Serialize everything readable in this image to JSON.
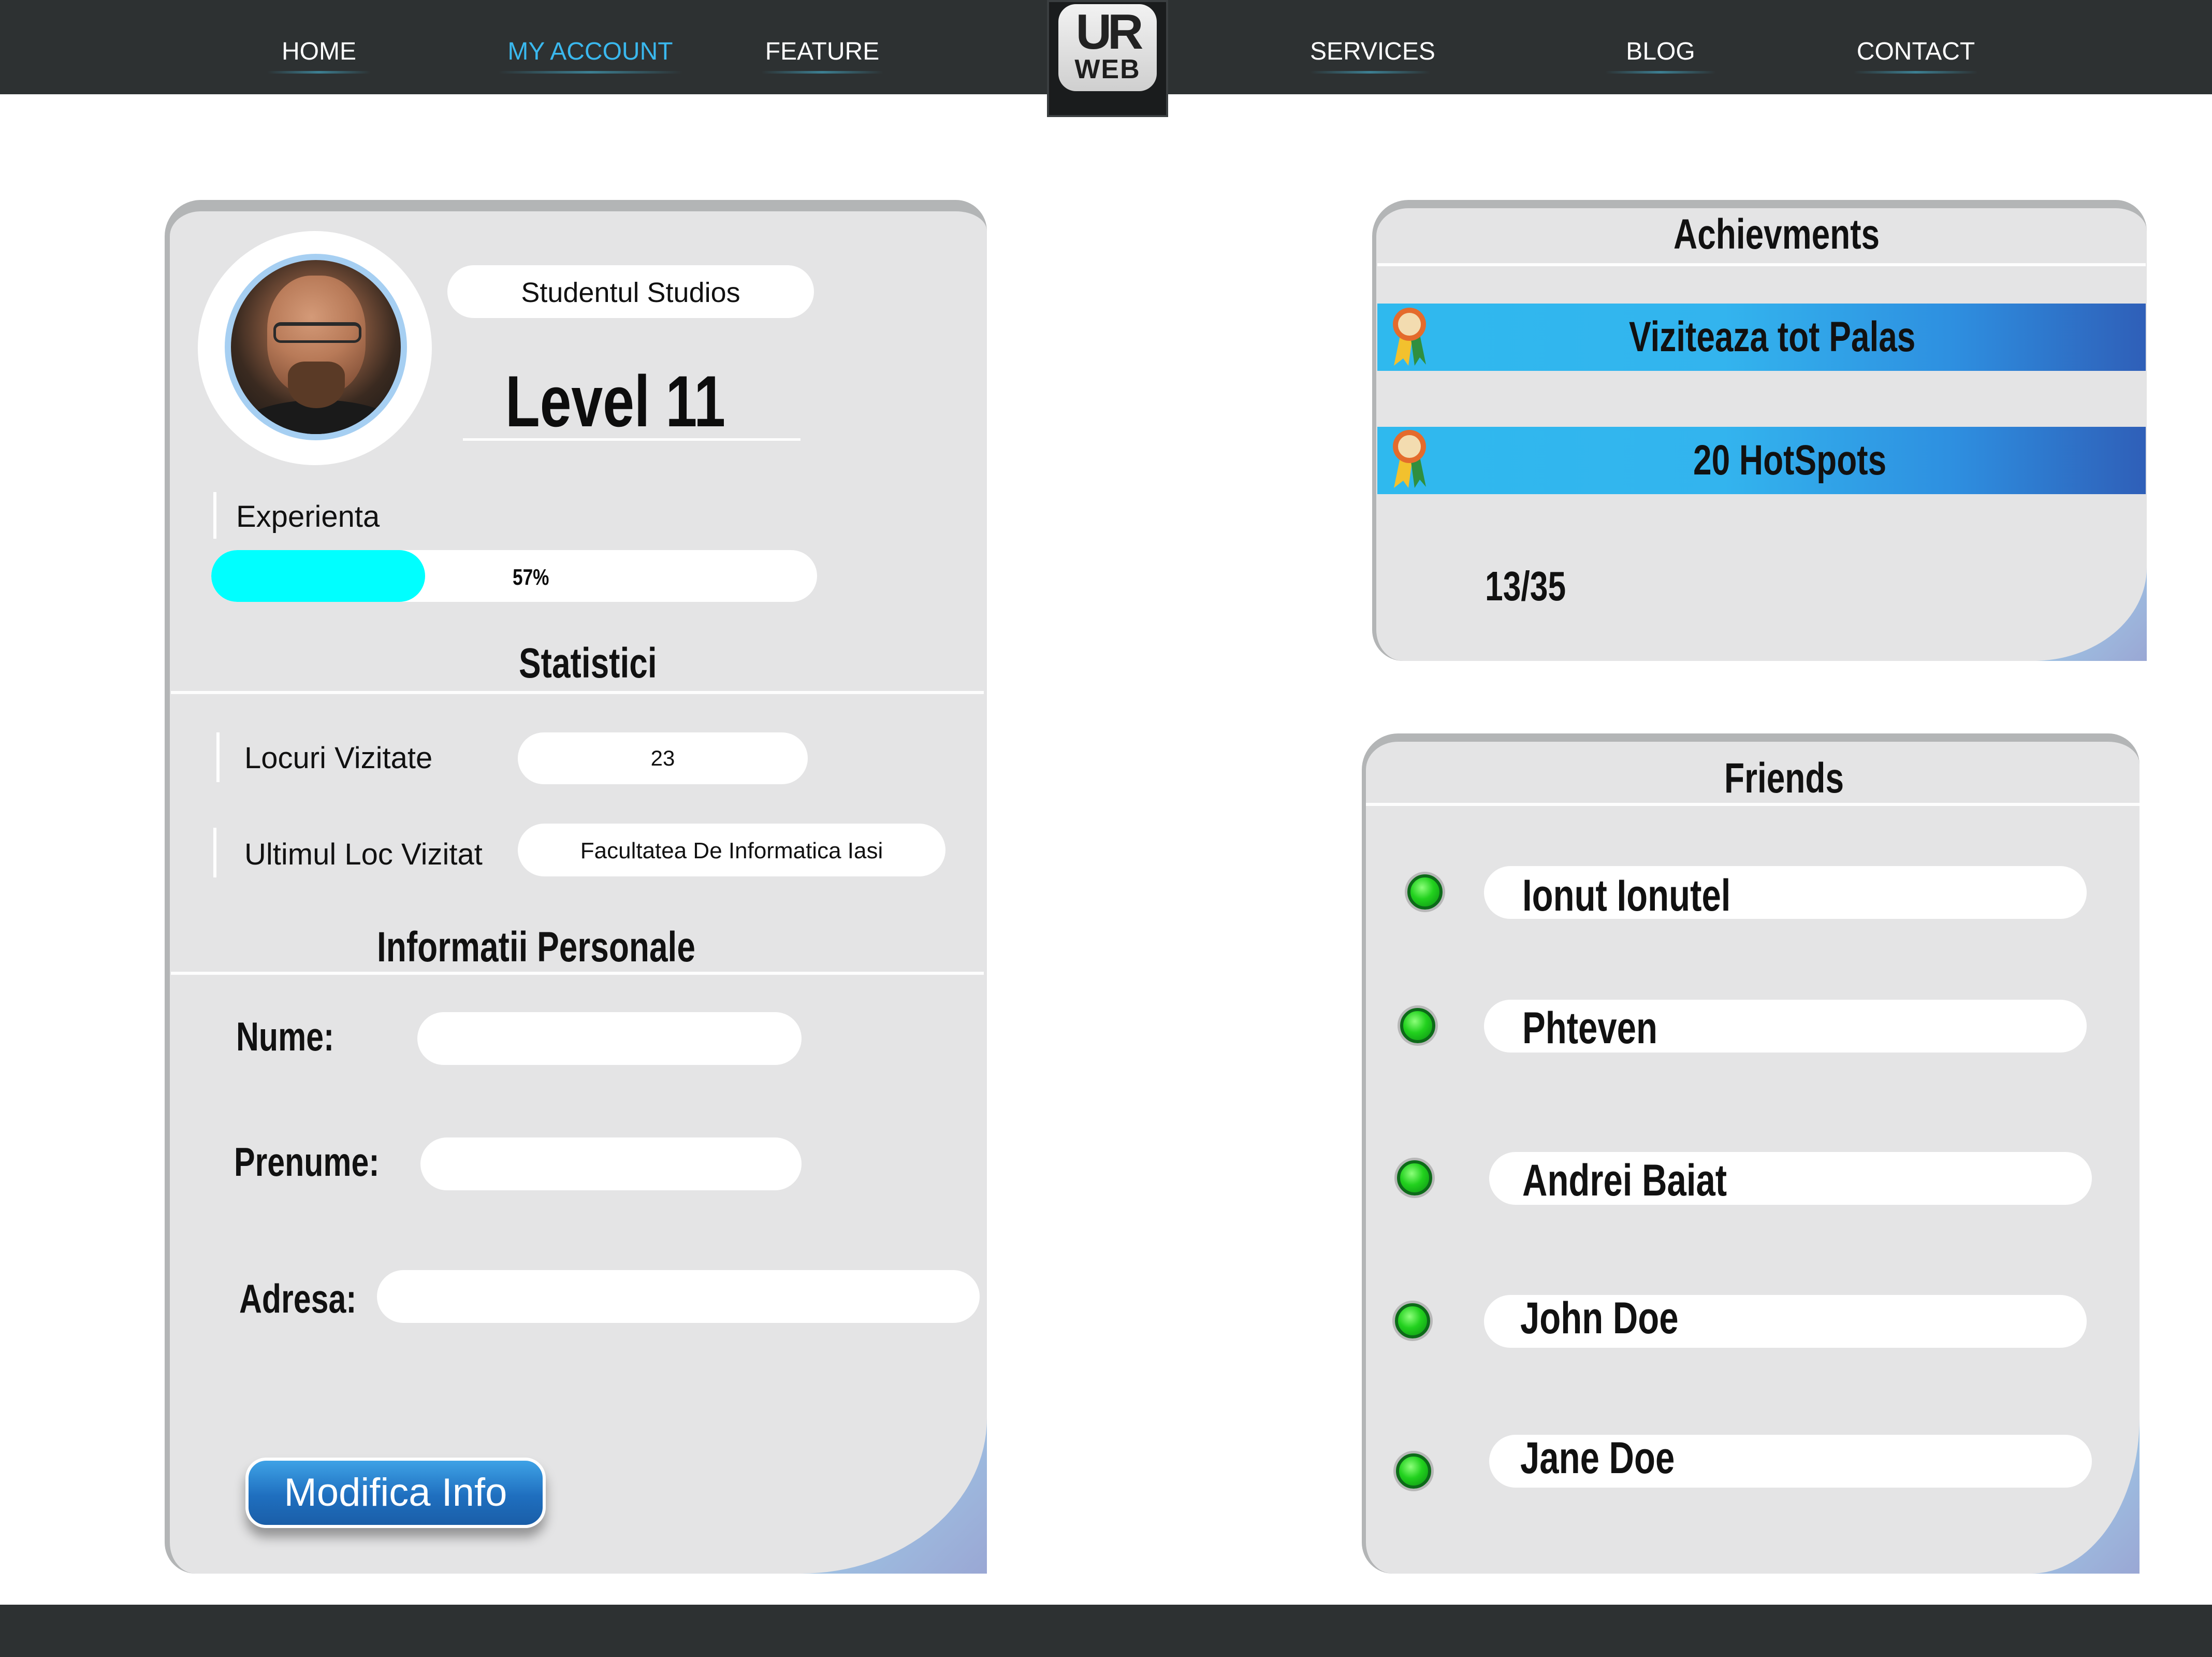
{
  "nav": {
    "items": [
      {
        "label": "HOME"
      },
      {
        "label": "MY ACCOUNT",
        "active": true
      },
      {
        "label": "FEATURE"
      },
      {
        "label": "SERVICES"
      },
      {
        "label": "BLOG"
      },
      {
        "label": "CONTACT"
      }
    ],
    "logo": {
      "top": "UR",
      "bottom": "WEB"
    }
  },
  "profile": {
    "username": "Studentul Studios",
    "level": "Level 11",
    "experience_label": "Experienta",
    "experience_percent": 57,
    "experience_text": "57%"
  },
  "stats": {
    "title": "Statistici",
    "locuri_label": "Locuri Vizitate",
    "locuri_value": "23",
    "ultimul_label": "Ultimul Loc Vizitat",
    "ultimul_value": "Facultatea De Informatica Iasi"
  },
  "personal": {
    "title": "Informatii Personale",
    "nume_label": "Nume:",
    "nume_value": "",
    "prenume_label": "Prenume:",
    "prenume_value": "",
    "adresa_label": "Adresa:",
    "adresa_value": "",
    "button_label": "Modifica Info"
  },
  "achievements": {
    "title": "Achievments",
    "items": [
      {
        "label": "Viziteaza tot Palas"
      },
      {
        "label": "20 HotSpots"
      }
    ],
    "count": "13/35"
  },
  "friends": {
    "title": "Friends",
    "items": [
      {
        "name": "Ionut Ionutel",
        "status": "online"
      },
      {
        "name": "Phteven",
        "status": "online"
      },
      {
        "name": "Andrei Baiat",
        "status": "online"
      },
      {
        "name": "John Doe",
        "status": "online"
      },
      {
        "name": "Jane Doe",
        "status": "online"
      }
    ]
  },
  "colors": {
    "nav_bg": "#2d3132",
    "accent": "#3ab8ee",
    "progress_fill": "#00ffff",
    "card_bg": "#e4e4e5",
    "online": "#22d11e",
    "button": "#1f6fbf"
  }
}
